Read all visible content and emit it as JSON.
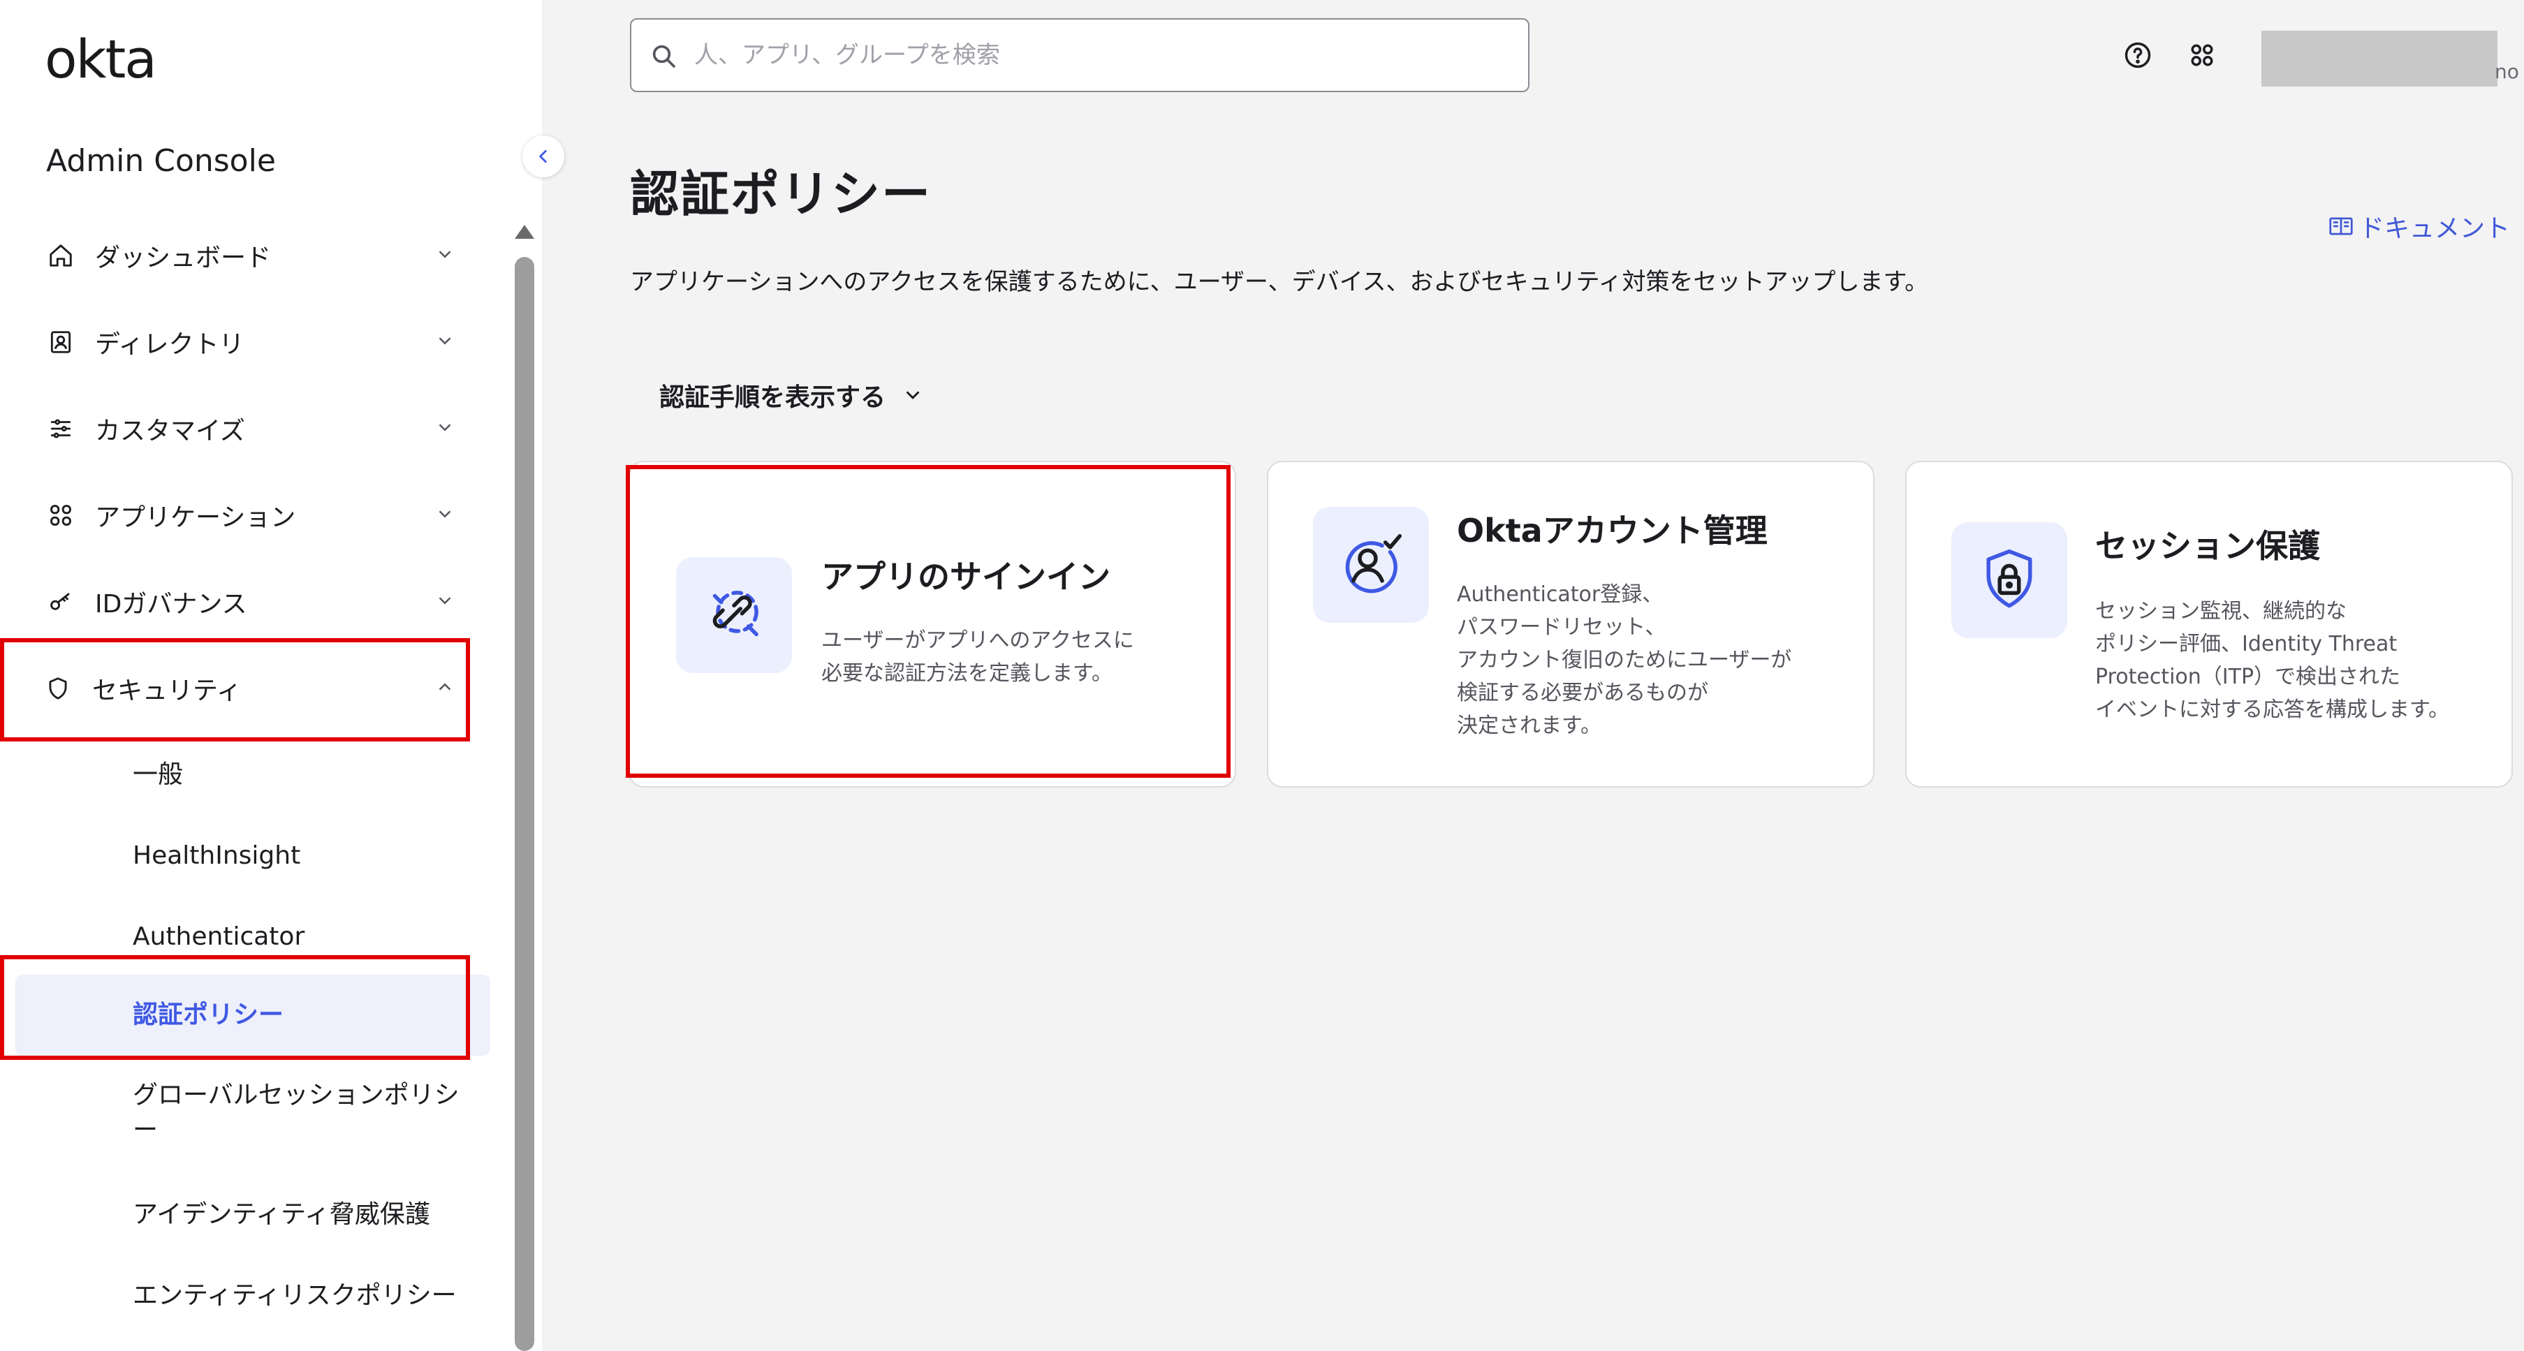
{
  "brand": {
    "logo_text": "okta",
    "console_title": "Admin Console"
  },
  "search": {
    "placeholder": "人、アプリ、グループを検索"
  },
  "header": {
    "help_icon": "question-circle-icon",
    "apps_icon": "grid-icon",
    "user_suffix": "no"
  },
  "sidebar": {
    "items": [
      {
        "label": "ダッシュボード",
        "icon": "home-icon",
        "expanded": false
      },
      {
        "label": "ディレクトリ",
        "icon": "directory-icon",
        "expanded": false
      },
      {
        "label": "カスタマイズ",
        "icon": "customize-icon",
        "expanded": false
      },
      {
        "label": "アプリケーション",
        "icon": "apps-icon",
        "expanded": false
      },
      {
        "label": "IDガバナンス",
        "icon": "key-icon",
        "expanded": false
      },
      {
        "label": "セキュリティ",
        "icon": "shield-icon",
        "expanded": true
      }
    ],
    "security_sub": [
      {
        "label": "一般"
      },
      {
        "label": "HealthInsight"
      },
      {
        "label": "Authenticator"
      },
      {
        "label": "認証ポリシー",
        "active": true
      },
      {
        "label": "グローバルセッションポリシ\nー"
      },
      {
        "label": "アイデンティティ脅威保護"
      },
      {
        "label": "エンティティリスクポリシー"
      }
    ]
  },
  "page": {
    "title": "認証ポリシー",
    "doc_link": "ドキュメント",
    "description": "アプリケーションへのアクセスを保護するために、ユーザー、デバイス、およびセキュリティ対策をセットアップします。",
    "steps_toggle": "認証手順を表示する"
  },
  "cards": [
    {
      "title": "アプリのサインイン",
      "desc": "ユーザーがアプリへのアクセスに\n必要な認証方法を定義します。",
      "icon": "app-signin-icon"
    },
    {
      "title": "Oktaアカウント管理",
      "desc": "Authenticator登録、\nパスワードリセット、\nアカウント復旧のためにユーザーが\n検証する必要があるものが\n決定されます。",
      "icon": "account-management-icon"
    },
    {
      "title": "セッション保護",
      "desc": "セッション監視、継続的な\nポリシー評価、Identity Threat\nProtection（ITP）で検出された\nイベントに対する応答を構成します。",
      "icon": "session-protection-icon"
    }
  ],
  "colors": {
    "accent": "#3f59e4",
    "highlight_box": "#e10000",
    "active_bg": "#eef0fb"
  }
}
